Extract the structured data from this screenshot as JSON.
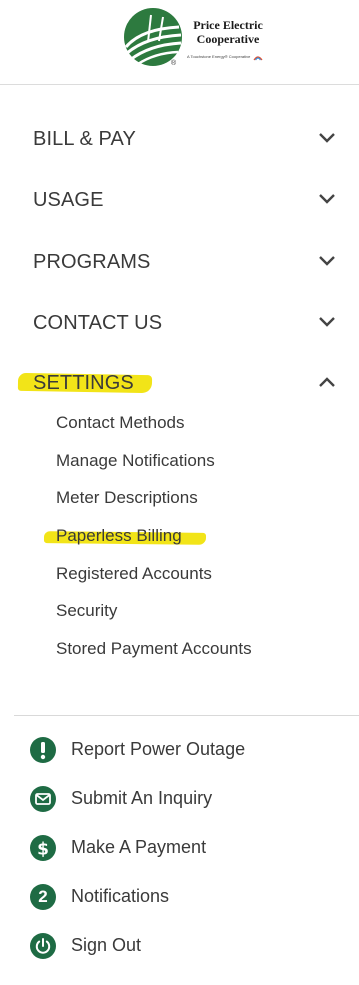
{
  "brand": {
    "name_line1": "Price Electric",
    "name_line2": "Cooperative",
    "tagline": "A Touchstone Energy® Cooperative",
    "registered": "®"
  },
  "nav": [
    {
      "label": "BILL & PAY",
      "state": "collapsed"
    },
    {
      "label": "USAGE",
      "state": "collapsed"
    },
    {
      "label": "PROGRAMS",
      "state": "collapsed"
    },
    {
      "label": "CONTACT US",
      "state": "collapsed"
    },
    {
      "label": "SETTINGS",
      "state": "expanded"
    }
  ],
  "settings_items": [
    "Contact Methods",
    "Manage Notifications",
    "Meter Descriptions",
    "Paperless Billing",
    "Registered Accounts",
    "Security",
    "Stored Payment Accounts"
  ],
  "actions": [
    {
      "label": "Report Power Outage",
      "icon": "exclamation-icon"
    },
    {
      "label": "Submit An Inquiry",
      "icon": "envelope-icon"
    },
    {
      "label": "Make A Payment",
      "icon": "dollar-icon"
    },
    {
      "label": "Notifications",
      "icon": "notification-count-icon",
      "badge": "2"
    },
    {
      "label": "Sign Out",
      "icon": "power-icon"
    }
  ],
  "colors": {
    "brand_green": "#1e6b44",
    "highlight": "#f2e418",
    "text": "#3a3a3a"
  }
}
